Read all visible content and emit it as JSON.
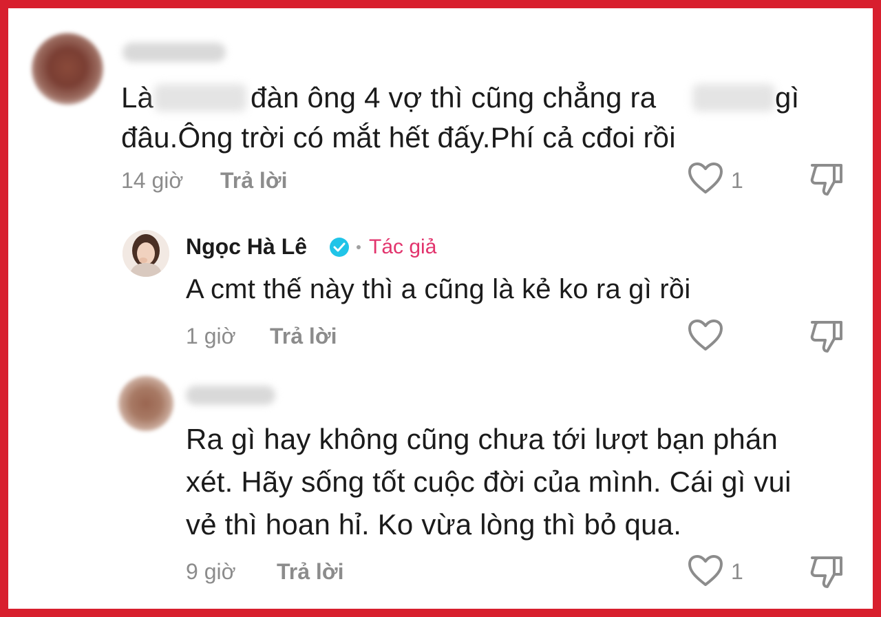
{
  "comment1": {
    "line1_parts": [
      "Là",
      "đàn ông 4 vợ thì cũng chẳng ra",
      "gì"
    ],
    "line2": "đâu.Ông trời có mắt hết đấy.Phí cả cđoi rồi",
    "time": "14 giờ",
    "reply": "Trả lời",
    "likes": "1"
  },
  "reply": {
    "author": "Ngọc Hà Lê",
    "tag": "Tác giả",
    "text": "A cmt thế này thì a cũng là kẻ ko ra gì rồi",
    "time": "1 giờ",
    "reply": "Trả lời"
  },
  "comment2": {
    "lines": [
      "Ra gì hay không cũng chưa tới lượt bạn phán",
      "xét. Hãy sống tốt cuộc đời của mình. Cái gì vui",
      "vẻ thì hoan hỉ. Ko vừa lòng thì bỏ qua."
    ],
    "time": "9 giờ",
    "reply": "Trả lời",
    "likes": "1"
  },
  "colors": {
    "frame": "#d81f2e",
    "author_tag": "#e2346d",
    "verified": "#20c4e8",
    "meta": "#8c8c8c"
  },
  "icons": [
    "heart-icon",
    "dislike-icon",
    "verified-badge-icon"
  ]
}
